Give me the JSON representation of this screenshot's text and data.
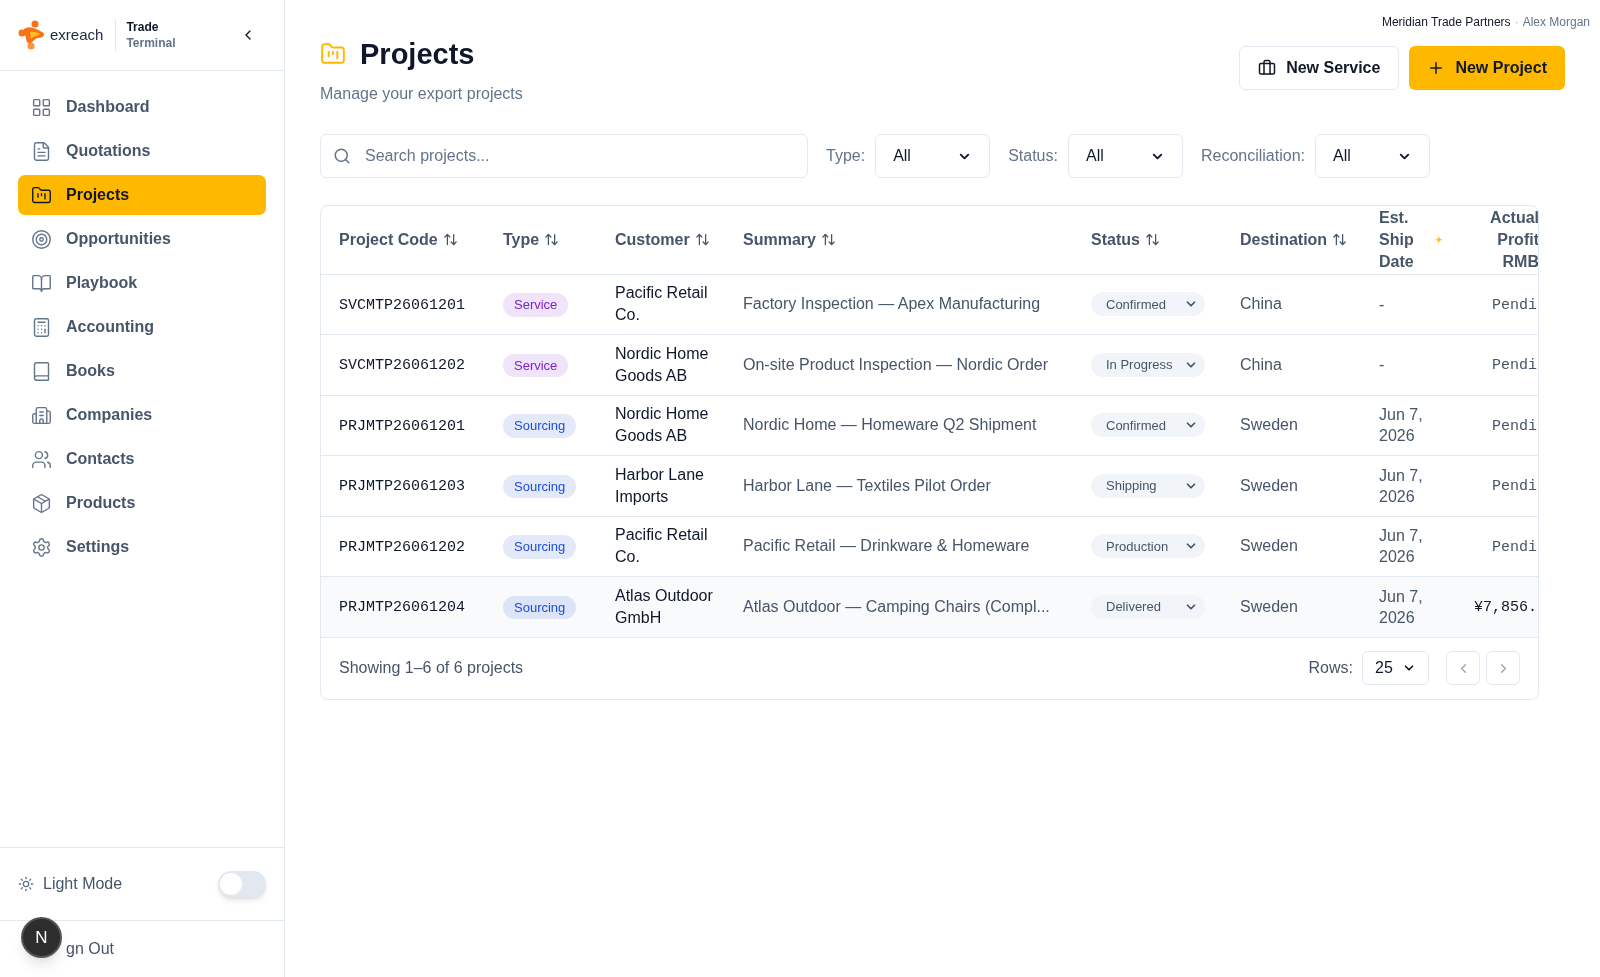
{
  "brand": {
    "name": "exreach",
    "product_line1": "Trade",
    "product_line2": "Terminal"
  },
  "sidebar": {
    "items": [
      {
        "label": "Dashboard",
        "selected": false
      },
      {
        "label": "Quotations",
        "selected": false
      },
      {
        "label": "Projects",
        "selected": true
      },
      {
        "label": "Opportunities",
        "selected": false
      },
      {
        "label": "Playbook",
        "selected": false
      },
      {
        "label": "Accounting",
        "selected": false
      },
      {
        "label": "Books",
        "selected": false
      },
      {
        "label": "Companies",
        "selected": false
      },
      {
        "label": "Contacts",
        "selected": false
      },
      {
        "label": "Products",
        "selected": false
      },
      {
        "label": "Settings",
        "selected": false
      }
    ],
    "theme_toggle": {
      "label": "Light Mode",
      "on": false
    },
    "sign_out": "gn Out",
    "dev_badge": "N"
  },
  "account": {
    "company": "Meridian Trade Partners",
    "separator": "·",
    "user": "Alex Morgan"
  },
  "page": {
    "title": "Projects",
    "subtitle": "Manage your export projects"
  },
  "actions": [
    {
      "label": "New Service",
      "kind": "secondary"
    },
    {
      "label": "New Project",
      "kind": "primary"
    }
  ],
  "search": {
    "placeholder": "Search projects..."
  },
  "filters": [
    {
      "label": "Type:",
      "value": "All"
    },
    {
      "label": "Status:",
      "value": "All"
    },
    {
      "label": "Reconciliation:",
      "value": "All"
    }
  ],
  "table": {
    "columns": [
      {
        "label": "Project Code",
        "sortable": true
      },
      {
        "label": "Type",
        "sortable": true
      },
      {
        "label": "Customer",
        "sortable": true
      },
      {
        "label": "Summary",
        "sortable": true
      },
      {
        "label": "Status",
        "sortable": true
      },
      {
        "label": "Destination",
        "sortable": true
      },
      {
        "label": "Est. Ship Date",
        "sortable": false,
        "marker": "✦"
      },
      {
        "label": "Actual Profit RMB",
        "sortable": false
      }
    ],
    "rows": [
      {
        "code": "SVCMTP26061201",
        "type": {
          "label": "Service",
          "color": "#7e22ce"
        },
        "customer": "Pacific Retail Co.",
        "summary": "Factory Inspection — Apex Manufacturing",
        "status": "Confirmed",
        "destination": "China",
        "ship_date": "-",
        "profit": "Pendi",
        "highlighted": false
      },
      {
        "code": "SVCMTP26061202",
        "type": {
          "label": "Service",
          "color": "#7e22ce"
        },
        "customer": "Nordic Home Goods AB",
        "summary": "On-site Product Inspection — Nordic Order",
        "status": "In Progress",
        "destination": "China",
        "ship_date": "-",
        "profit": "Pendi",
        "highlighted": false
      },
      {
        "code": "PRJMTP26061201",
        "type": {
          "label": "Sourcing",
          "color": "#1d4ed8"
        },
        "customer": "Nordic Home Goods AB",
        "summary": "Nordic Home — Homeware Q2 Shipment",
        "status": "Confirmed",
        "destination": "Sweden",
        "ship_date": "Jun 7, 2026",
        "profit": "Pendi",
        "highlighted": false
      },
      {
        "code": "PRJMTP26061203",
        "type": {
          "label": "Sourcing",
          "color": "#1d4ed8"
        },
        "customer": "Harbor Lane Imports",
        "summary": "Harbor Lane — Textiles Pilot Order",
        "status": "Shipping",
        "destination": "Sweden",
        "ship_date": "Jun 7, 2026",
        "profit": "Pendi",
        "highlighted": false
      },
      {
        "code": "PRJMTP26061202",
        "type": {
          "label": "Sourcing",
          "color": "#1d4ed8"
        },
        "customer": "Pacific Retail Co.",
        "summary": "Pacific Retail — Drinkware & Homeware",
        "status": "Production",
        "destination": "Sweden",
        "ship_date": "Jun 7, 2026",
        "profit": "Pendi",
        "highlighted": false
      },
      {
        "code": "PRJMTP26061204",
        "type": {
          "label": "Sourcing",
          "color": "#1d4ed8"
        },
        "customer": "Atlas Outdoor GmbH",
        "summary": "Atlas Outdoor — Camping Chairs (Compl...",
        "status": "Delivered",
        "destination": "Sweden",
        "ship_date": "Jun 7, 2026",
        "profit": "¥7,856.",
        "highlighted": true
      }
    ]
  },
  "footer": {
    "showing": "Showing 1–6 of 6 projects",
    "rows_label": "Rows:",
    "rows_value": "25"
  }
}
